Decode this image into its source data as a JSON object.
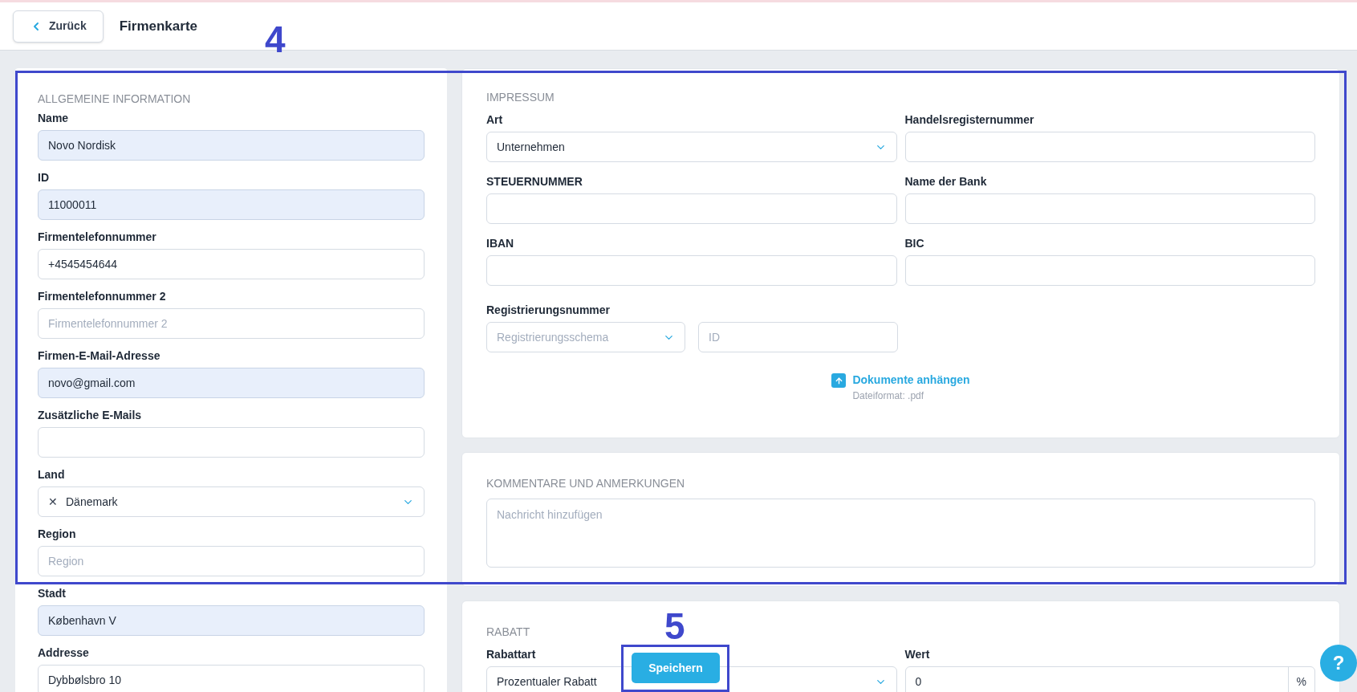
{
  "header": {
    "back_button": "Zurück",
    "title": "Firmenkarte"
  },
  "general": {
    "heading": "ALLGEMEINE INFORMATION",
    "fields": [
      {
        "kind": "text",
        "label": "Name",
        "value": "Novo Nordisk",
        "highlighted": true
      },
      {
        "kind": "text",
        "label": "ID",
        "value": "11000011",
        "highlighted": true
      },
      {
        "kind": "text",
        "label": "Firmentelefonnummer",
        "value": "+4545454644",
        "highlighted": false
      },
      {
        "kind": "text",
        "label": "Firmentelefonnummer 2",
        "placeholder": "Firmentelefonnummer 2",
        "highlighted": false
      },
      {
        "kind": "text",
        "label": "Firmen-E-Mail-Adresse",
        "value": "novo@gmail.com",
        "highlighted": true
      },
      {
        "kind": "text",
        "label": "Zusätzliche E-Mails",
        "highlighted": false
      },
      {
        "kind": "select",
        "label": "Land",
        "value": "Dänemark",
        "clear_icon": "✕",
        "highlighted": false
      },
      {
        "kind": "text",
        "label": "Region",
        "placeholder": "Region",
        "highlighted": false
      },
      {
        "kind": "text",
        "label": "Stadt",
        "value": "København V",
        "highlighted": true
      },
      {
        "kind": "text",
        "label": "Addresse",
        "value": "Dybbølsbro 10",
        "highlighted": false
      }
    ]
  },
  "impressum": {
    "heading": "IMPRESSUM",
    "fields": [
      {
        "kind": "select",
        "label": "Art",
        "value": "Unternehmen"
      },
      {
        "kind": "text",
        "label": "Handelsregisternummer"
      },
      {
        "kind": "text",
        "label": "STEUERNUMMER"
      },
      {
        "kind": "text",
        "label": "Name der Bank"
      },
      {
        "kind": "text",
        "label": "IBAN"
      },
      {
        "kind": "text",
        "label": "BIC"
      }
    ],
    "registration": {
      "label": "Registrierungsnummer",
      "scheme_placeholder": "Registrierungsschema",
      "id_placeholder": "ID"
    },
    "attach": {
      "link": "Dokumente anhängen",
      "hint": "Dateiformat: .pdf"
    }
  },
  "comments": {
    "heading": "KOMMENTARE UND ANMERKUNGEN",
    "placeholder": "Nachricht hinzufügen"
  },
  "discount": {
    "heading": "RABATT",
    "fields": [
      {
        "kind": "select",
        "label": "Rabattart",
        "value": "Prozentualer Rabatt"
      },
      {
        "kind": "number",
        "label": "Wert",
        "value": "0",
        "suffix": "%"
      }
    ]
  },
  "save_button": "Speichern",
  "help_button": "?",
  "annotations": [
    {
      "label": "4"
    },
    {
      "label": "5"
    }
  ]
}
